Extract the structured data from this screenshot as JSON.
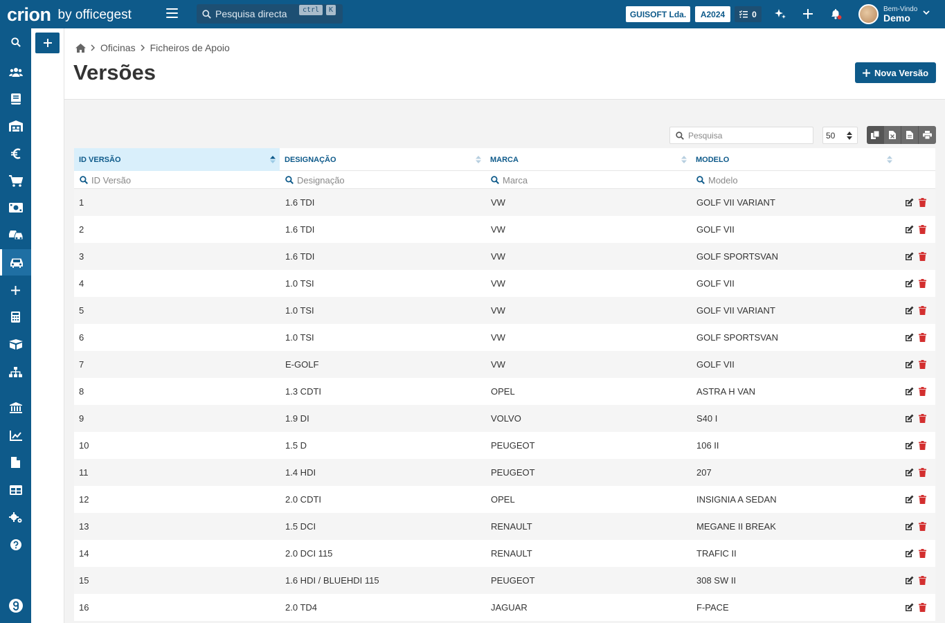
{
  "topbar": {
    "logo_main": "crion",
    "logo_sub": "by officegest",
    "search_placeholder": "Pesquisa directa",
    "kbd_ctrl": "ctrl",
    "kbd_k": "K",
    "company": "GUISOFT Lda.",
    "year": "A2024",
    "tasks_count": "0",
    "welcome": "Bem-Vindo",
    "user": "Demo"
  },
  "breadcrumb": {
    "item1": "Oficinas",
    "item2": "Ficheiros de Apoio"
  },
  "page_title": "Versões",
  "new_button": "Nova Versão",
  "controls": {
    "search_placeholder": "Pesquisa",
    "page_size": "50"
  },
  "table": {
    "headers": {
      "id": "ID VERSÃO",
      "designacao": "DESIGNAÇÃO",
      "marca": "MARCA",
      "modelo": "MODELO"
    },
    "filters": {
      "id": "ID Versão",
      "designacao": "Designação",
      "marca": "Marca",
      "modelo": "Modelo"
    },
    "rows": [
      [
        "1",
        "1.6 TDI",
        "VW",
        "GOLF VII VARIANT"
      ],
      [
        "2",
        "1.6 TDI",
        "VW",
        "GOLF VII"
      ],
      [
        "3",
        "1.6 TDI",
        "VW",
        "GOLF SPORTSVAN"
      ],
      [
        "4",
        "1.0 TSI",
        "VW",
        "GOLF VII"
      ],
      [
        "5",
        "1.0 TSI",
        "VW",
        "GOLF VII VARIANT"
      ],
      [
        "6",
        "1.0 TSI",
        "VW",
        "GOLF SPORTSVAN"
      ],
      [
        "7",
        "E-GOLF",
        "VW",
        "GOLF VII"
      ],
      [
        "8",
        "1.3 CDTI",
        "OPEL",
        "ASTRA H VAN"
      ],
      [
        "9",
        "1.9 DI",
        "VOLVO",
        "S40 I"
      ],
      [
        "10",
        "1.5 D",
        "PEUGEOT",
        "106 II"
      ],
      [
        "11",
        "1.4 HDI",
        "PEUGEOT",
        "207"
      ],
      [
        "12",
        "2.0 CDTI",
        "OPEL",
        "INSIGNIA A SEDAN"
      ],
      [
        "13",
        "1.5 DCI",
        "RENAULT",
        "MEGANE II BREAK"
      ],
      [
        "14",
        "2.0 DCI 115",
        "RENAULT",
        "TRAFIC II"
      ],
      [
        "15",
        "1.6 HDI / BLUEHDI 115",
        "PEUGEOT",
        "308 SW II"
      ],
      [
        "16",
        "2.0 TD4",
        "JAGUAR",
        "F-PACE"
      ]
    ]
  },
  "sidebar_icons": [
    "search-icon",
    "users-icon",
    "book-icon",
    "warehouse-icon",
    "euro-icon",
    "cart-icon",
    "money-icon",
    "car-crash-icon",
    "car-icon",
    "plus-icon",
    "calculator-icon",
    "box-icon",
    "sitemap-icon",
    "bank-icon",
    "chart-icon",
    "file-icon",
    "table-icon",
    "cogs-icon",
    "help-icon"
  ],
  "colors": {
    "primary": "#0e5a8a",
    "delete": "#d32f2f",
    "sorted_header": "#d9effb"
  }
}
